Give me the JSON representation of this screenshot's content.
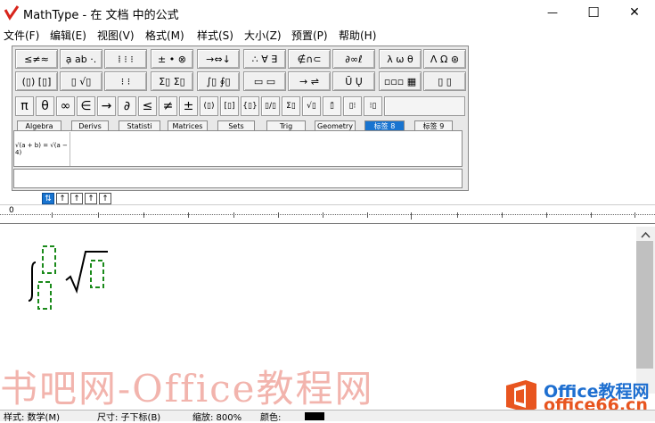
{
  "window": {
    "title": "MathType - 在 文档 中的公式",
    "minimize": "—",
    "maximize": "☐",
    "close": "✕"
  },
  "menu": [
    "文件(F)",
    "编辑(E)",
    "视图(V)",
    "格式(M)",
    "样式(S)",
    "大小(Z)",
    "预置(P)",
    "帮助(H)"
  ],
  "palette_row1": [
    "≤≠≈",
    "ạ ab ·.",
    "⁞ ⁝ ⁝",
    "± • ⊗",
    "→⇔↓",
    "∴ ∀ ∃",
    "∉∩⊂",
    "∂∞ℓ",
    "λ ω θ",
    "Λ Ω ⊛"
  ],
  "palette_row2": [
    "(▯) [▯]",
    "▯ √▯",
    "⁝ ⁝",
    "Σ▯ Σ▯",
    "∫▯ ∮▯",
    "▭ ▭",
    "→ ⇌",
    "Ū Ų",
    "▫▫▫ ▦",
    "▯ ▯"
  ],
  "symbols": [
    "π",
    "θ",
    "∞",
    "∈",
    "→",
    "∂",
    "≤",
    "≠",
    "±",
    "(▯)",
    "[▯]",
    "{▯}",
    "▯/▯",
    "Σ▯",
    "√▯",
    "▯̄",
    "▯⁝",
    "⁝▯"
  ],
  "tabs": [
    "Algebra",
    "Derivs",
    "Statisti",
    "Matrices",
    "Sets",
    "Trig",
    "Geometry",
    "标签 8",
    "标签 9"
  ],
  "saved_expression": "√(a + b) = √(a − 4)",
  "nav_buttons": [
    "⇅",
    "↑",
    "↑",
    "↑",
    "↑"
  ],
  "ruler_zero": "0",
  "status": {
    "style": "样式: 数学(M)",
    "size": "尺寸: 子下标(B)",
    "zoom": "缩放: 800%",
    "color": "颜色:"
  },
  "watermark": {
    "text": "书吧网-Office教程网",
    "logo_line1": "Office教程网",
    "logo_line2": "office66.cn"
  },
  "colors": {
    "accent": "#1874d0",
    "placeholder_green": "#1a8a1a",
    "logo_red": "#d8251c",
    "watermark_red": "#e2584a"
  }
}
